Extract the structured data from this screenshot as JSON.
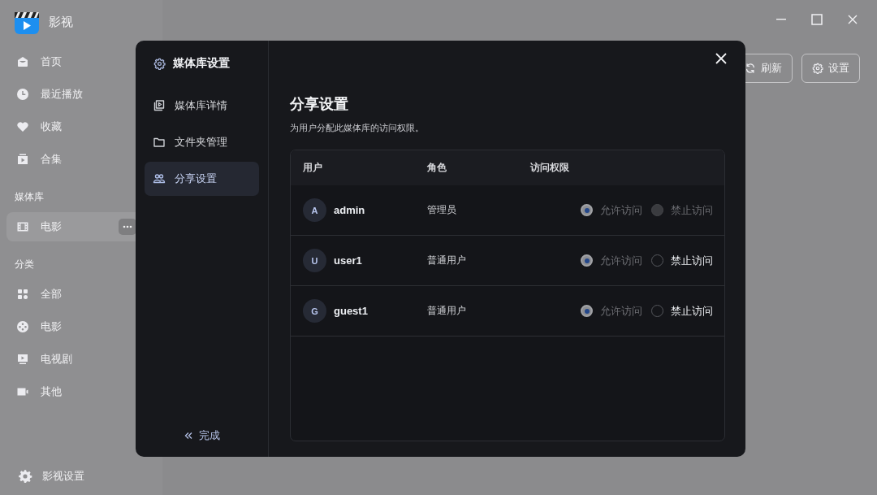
{
  "app": {
    "title": "影视"
  },
  "sidebar": {
    "groups": [
      {
        "items": [
          {
            "label": "首页",
            "selected": false
          },
          {
            "label": "最近播放",
            "selected": false
          },
          {
            "label": "收藏",
            "selected": false
          },
          {
            "label": "合集",
            "selected": false
          }
        ]
      },
      {
        "heading": "媒体库",
        "items": [
          {
            "label": "电影",
            "selected": true
          }
        ]
      },
      {
        "heading": "分类",
        "items": [
          {
            "label": "全部",
            "selected": false
          },
          {
            "label": "电影",
            "selected": false
          },
          {
            "label": "电视剧",
            "selected": false
          },
          {
            "label": "其他",
            "selected": false
          }
        ]
      }
    ],
    "footer": "影视设置"
  },
  "toolbar": {
    "buttons": [
      "刷新",
      "设置"
    ]
  },
  "dialog": {
    "title": "媒体库设置",
    "nav": [
      {
        "label": "媒体库详情",
        "selected": false
      },
      {
        "label": "文件夹管理",
        "selected": false
      },
      {
        "label": "分享设置",
        "selected": true
      }
    ],
    "done": "完成",
    "heading": "分享设置",
    "description": "为用户分配此媒体库的访问权限。",
    "columns": [
      "用户",
      "角色",
      "访问权限"
    ],
    "rows": [
      {
        "avatar": "A",
        "name": "admin",
        "role": "管理员",
        "options": [
          {
            "label": "允许访问",
            "selected": true,
            "disabled": true
          },
          {
            "label": "禁止访问",
            "selected": false,
            "disabled": true
          }
        ]
      },
      {
        "avatar": "U",
        "name": "user1",
        "role": "普通用户",
        "options": [
          {
            "label": "允许访问",
            "selected": true,
            "disabled": true
          },
          {
            "label": "禁止访问",
            "selected": false,
            "disabled": false
          }
        ]
      },
      {
        "avatar": "G",
        "name": "guest1",
        "role": "普通用户",
        "options": [
          {
            "label": "允许访问",
            "selected": true,
            "disabled": true
          },
          {
            "label": "禁止访问",
            "selected": false,
            "disabled": false
          }
        ]
      }
    ]
  }
}
